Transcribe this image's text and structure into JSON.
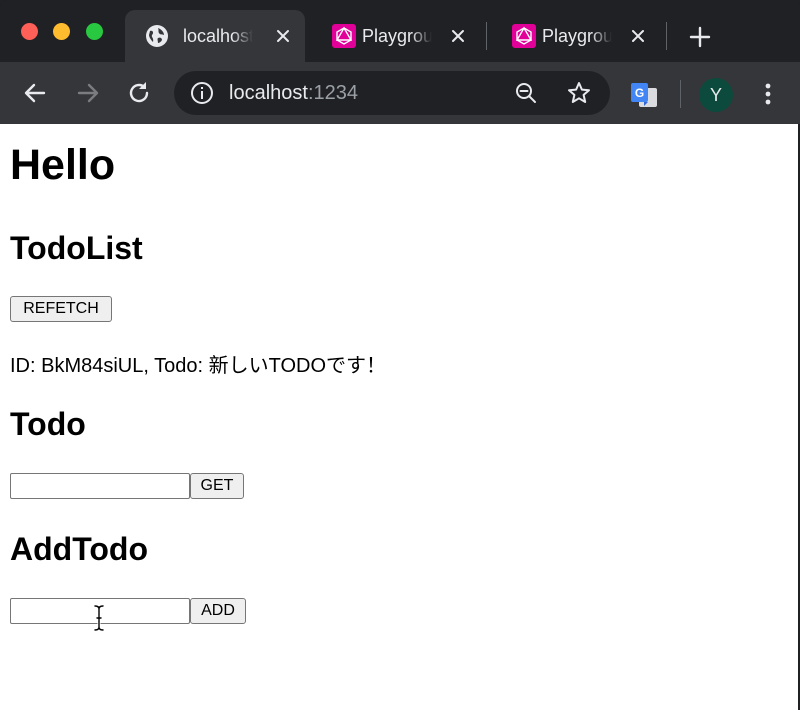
{
  "browser": {
    "tabs": [
      {
        "label": "localhost",
        "icon": "globe-icon",
        "active": true
      },
      {
        "label": "Playground",
        "icon": "graphql-icon",
        "active": false
      },
      {
        "label": "Playground",
        "icon": "graphql-icon",
        "active": false
      }
    ],
    "url_host": "localhost",
    "url_port": ":1234",
    "avatar_initial": "Y",
    "colors": {
      "frame": "#202124",
      "toolbar": "#35363a",
      "graphql_pink": "#e10098",
      "avatar": "#0b4a3c"
    }
  },
  "page": {
    "title": "Hello",
    "todolist": {
      "heading": "TodoList",
      "refetch_label": "REFETCH",
      "item_text": "ID: BkM84siUL, Todo: 新しいTODOです！"
    },
    "todo": {
      "heading": "Todo",
      "input_value": "",
      "get_label": "GET"
    },
    "addtodo": {
      "heading": "AddTodo",
      "input_value": "",
      "add_label": "ADD"
    }
  }
}
